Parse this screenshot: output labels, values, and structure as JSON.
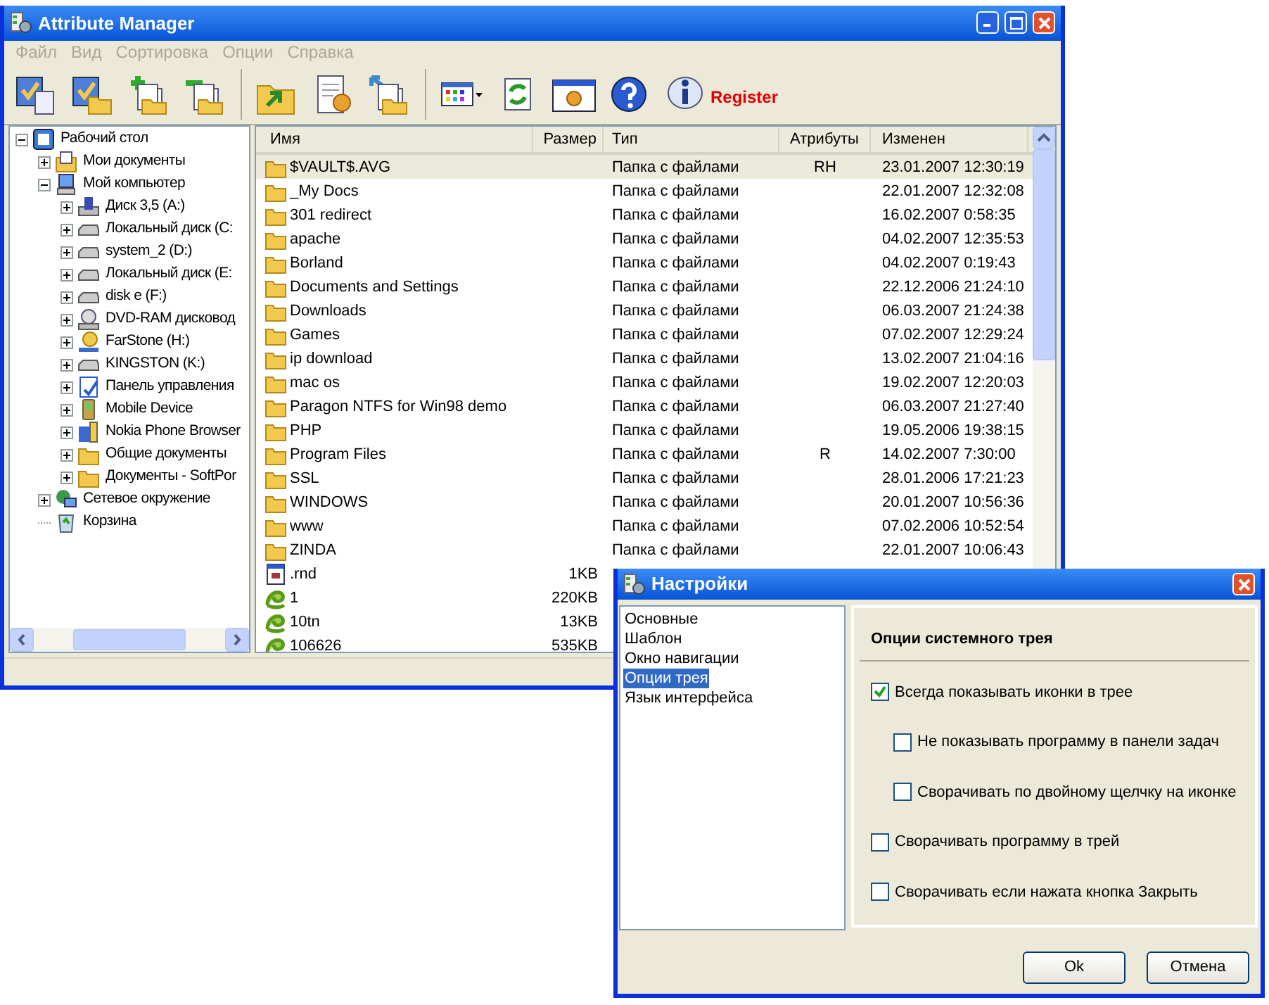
{
  "window": {
    "title": "Attribute Manager"
  },
  "menu": [
    "Файл",
    "Вид",
    "Сортировка",
    "Опции",
    "Справка"
  ],
  "toolbar": {
    "register_label": "Register"
  },
  "tree": [
    {
      "label": "Рабочий стол",
      "kind": "desktop",
      "expandable": true,
      "expanded": true,
      "children": [
        {
          "label": "Мои документы",
          "kind": "documents",
          "expandable": true,
          "expanded": false
        },
        {
          "label": "Мой компьютер",
          "kind": "computer",
          "expandable": true,
          "expanded": true,
          "children": [
            {
              "label": "Диск 3,5 (A:)",
              "kind": "floppy",
              "expandable": true,
              "expanded": false
            },
            {
              "label": "Локальный диск (C:",
              "kind": "drive",
              "expandable": true,
              "expanded": false
            },
            {
              "label": "system_2 (D:)",
              "kind": "drive",
              "expandable": true,
              "expanded": false
            },
            {
              "label": "Локальный диск (E:",
              "kind": "drive",
              "expandable": true,
              "expanded": false
            },
            {
              "label": "disk e (F:)",
              "kind": "drive",
              "expandable": true,
              "expanded": false
            },
            {
              "label": "DVD-RAM дисковод",
              "kind": "dvd",
              "expandable": true,
              "expanded": false
            },
            {
              "label": "FarStone (H:)",
              "kind": "cd",
              "expandable": true,
              "expanded": false
            },
            {
              "label": "KINGSTON (K:)",
              "kind": "drive",
              "expandable": true,
              "expanded": false
            },
            {
              "label": "Панель управления",
              "kind": "control",
              "expandable": true,
              "expanded": false
            },
            {
              "label": "Mobile Device",
              "kind": "mobile",
              "expandable": true,
              "expanded": false
            },
            {
              "label": "Nokia Phone Browser",
              "kind": "phone",
              "expandable": true,
              "expanded": false
            },
            {
              "label": "Общие документы",
              "kind": "folder",
              "expandable": true,
              "expanded": false
            },
            {
              "label": "Документы - SoftPor",
              "kind": "folder",
              "expandable": true,
              "expanded": false
            }
          ]
        },
        {
          "label": "Сетевое окружение",
          "kind": "network",
          "expandable": true,
          "expanded": false
        },
        {
          "label": "Корзина",
          "kind": "trash",
          "expandable": false,
          "expanded": false
        }
      ]
    }
  ],
  "file_list": {
    "columns": [
      "Имя",
      "Размер",
      "Тип",
      "Атрибуты",
      "Изменен"
    ],
    "rows": [
      {
        "kind": "folder",
        "name": "$VAULT$.AVG",
        "type": "Папка с файлами",
        "attributes": "RH",
        "modified": "23.01.2007 12:30:19",
        "selected": true
      },
      {
        "kind": "folder",
        "name": "_My Docs",
        "type": "Папка с файлами",
        "modified": "22.01.2007 12:32:08",
        "selected": false
      },
      {
        "kind": "folder",
        "name": "301 redirect",
        "type": "Папка с файлами",
        "modified": "16.02.2007 0:58:35",
        "selected": false
      },
      {
        "kind": "folder",
        "name": "apache",
        "type": "Папка с файлами",
        "modified": "04.02.2007 12:35:53",
        "selected": false
      },
      {
        "kind": "folder",
        "name": "Borland",
        "type": "Папка с файлами",
        "modified": "04.02.2007 0:19:43",
        "selected": false
      },
      {
        "kind": "folder",
        "name": "Documents and Settings",
        "type": "Папка с файлами",
        "modified": "22.12.2006 21:24:10",
        "selected": false
      },
      {
        "kind": "folder",
        "name": "Downloads",
        "type": "Папка с файлами",
        "modified": "06.03.2007 21:24:38",
        "selected": false
      },
      {
        "kind": "folder",
        "name": "Games",
        "type": "Папка с файлами",
        "modified": "07.02.2007 12:29:24",
        "selected": false
      },
      {
        "kind": "folder",
        "name": "ip download",
        "type": "Папка с файлами",
        "modified": "13.02.2007 21:04:16",
        "selected": false
      },
      {
        "kind": "folder",
        "name": "mac os",
        "type": "Папка с файлами",
        "modified": "19.02.2007 12:20:03",
        "selected": false
      },
      {
        "kind": "folder",
        "name": "Paragon NTFS for Win98 demo",
        "type": "Папка с файлами",
        "modified": "06.03.2007 21:27:40",
        "selected": false
      },
      {
        "kind": "folder",
        "name": "PHP",
        "type": "Папка с файлами",
        "modified": "19.05.2006 19:38:15",
        "selected": false
      },
      {
        "kind": "folder",
        "name": "Program Files",
        "type": "Папка с файлами",
        "attributes": "R",
        "modified": "14.02.2007 7:30:00",
        "selected": false
      },
      {
        "kind": "folder",
        "name": "SSL",
        "type": "Папка с файлами",
        "modified": "28.01.2006 17:21:23",
        "selected": false
      },
      {
        "kind": "folder",
        "name": "WINDOWS",
        "type": "Папка с файлами",
        "modified": "20.01.2007 10:56:36",
        "selected": false
      },
      {
        "kind": "folder",
        "name": "www",
        "type": "Папка с файлами",
        "modified": "07.02.2006 10:52:54",
        "selected": false
      },
      {
        "kind": "folder",
        "name": "ZINDA",
        "type": "Папка с файлами",
        "modified": "22.01.2007 10:06:43",
        "selected": false
      },
      {
        "kind": "document",
        "name": ".rnd",
        "size": "1KB",
        "selected": false
      },
      {
        "kind": "program",
        "name": "1",
        "size": "220KB",
        "selected": false
      },
      {
        "kind": "program",
        "name": "10tn",
        "size": "13KB",
        "selected": false
      },
      {
        "kind": "program",
        "name": "106626",
        "size": "535KB",
        "selected": false
      }
    ]
  },
  "dialog": {
    "title": "Настройки",
    "sections": [
      {
        "label": "Основные",
        "selected": false
      },
      {
        "label": "Шаблон",
        "selected": false
      },
      {
        "label": "Окно навигации",
        "selected": false
      },
      {
        "label": "Опции трея",
        "selected": true
      },
      {
        "label": "Язык интерфейса",
        "selected": false
      }
    ],
    "panel_title": "Опции системного трея",
    "options": [
      {
        "label": "Всегда показывать иконки в трее",
        "checked": true,
        "children": [
          {
            "label": "Не показывать программу в панели задач",
            "checked": false
          },
          {
            "label": "Сворачивать по двойному щелчку на иконке",
            "checked": false
          }
        ]
      },
      {
        "label": "Сворачивать программу в трей",
        "checked": false
      },
      {
        "label": "Сворачивать если нажата кнопка Закрыть",
        "checked": false
      }
    ],
    "buttons": [
      "Ok",
      "Отмена"
    ]
  }
}
